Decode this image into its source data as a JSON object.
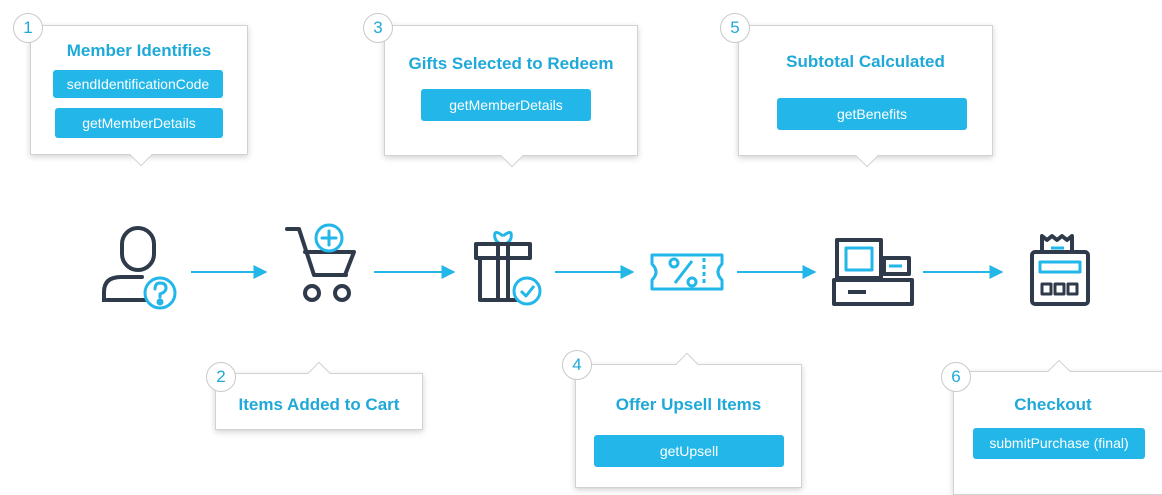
{
  "steps": [
    {
      "number": "1",
      "title": "Member Identifies",
      "chips": [
        "sendIdentificationCode",
        "getMemberDetails"
      ]
    },
    {
      "number": "2",
      "title": "Items Added to Cart",
      "chips": []
    },
    {
      "number": "3",
      "title": "Gifts Selected to Redeem",
      "chips": [
        "getMemberDetails"
      ]
    },
    {
      "number": "4",
      "title": "Offer Upsell Items",
      "chips": [
        "getUpsell"
      ]
    },
    {
      "number": "5",
      "title": "Subtotal Calculated",
      "chips": [
        "getBenefits"
      ]
    },
    {
      "number": "6",
      "title": "Checkout",
      "chips": [
        "submitPurchase (final)"
      ]
    }
  ],
  "colors": {
    "accent": "#22b7e8",
    "title": "#1fa9d8",
    "icon": "#2f3a4b",
    "border": "#d2d2d2"
  },
  "icons": [
    "member-question-icon",
    "cart-add-icon",
    "gift-check-icon",
    "coupon-percent-icon",
    "cash-register-icon",
    "receipt-terminal-icon"
  ]
}
